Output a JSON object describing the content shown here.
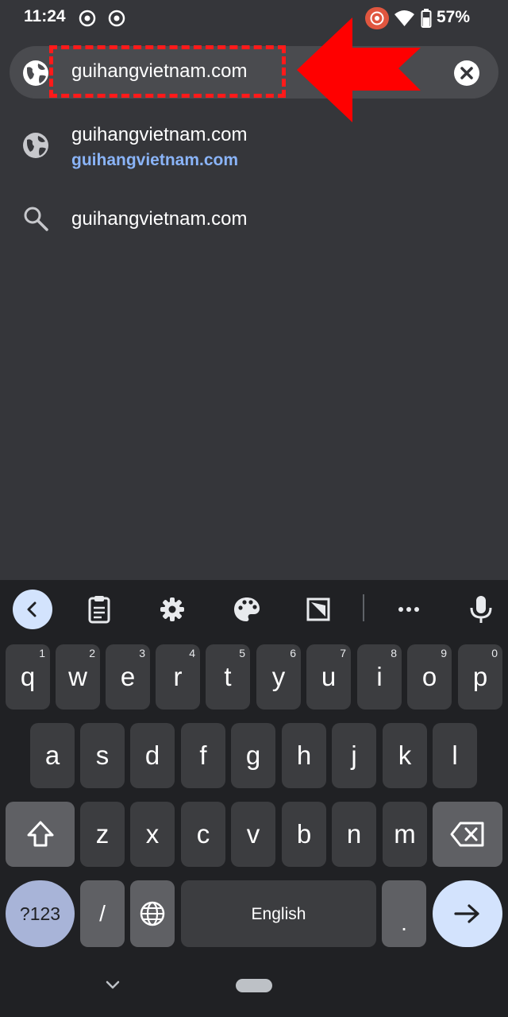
{
  "status_bar": {
    "time": "11:24",
    "battery": "57%",
    "icons": [
      "radar-icon",
      "radar-icon",
      "screen-record-icon",
      "wifi-icon",
      "battery-icon"
    ]
  },
  "omnibox": {
    "value": "guihangvietnam.com",
    "left_icon": "globe-icon",
    "clear_icon": "clear-icon"
  },
  "annotation": {
    "color": "#ff0000",
    "shapes": [
      "dashed-highlight-box",
      "arrow-left-icon"
    ]
  },
  "suggestions": [
    {
      "icon": "globe-icon",
      "title": "guihangvietnam.com",
      "url": "guihangvietnam.com"
    },
    {
      "icon": "search-icon",
      "title": "guihangvietnam.com"
    }
  ],
  "keyboard": {
    "toolbar": [
      "back-icon",
      "clipboard-icon",
      "gear-icon",
      "palette-icon",
      "resize-icon",
      "more-icon",
      "mic-icon"
    ],
    "row1": [
      {
        "k": "q",
        "h": "1"
      },
      {
        "k": "w",
        "h": "2"
      },
      {
        "k": "e",
        "h": "3"
      },
      {
        "k": "r",
        "h": "4"
      },
      {
        "k": "t",
        "h": "5"
      },
      {
        "k": "y",
        "h": "6"
      },
      {
        "k": "u",
        "h": "7"
      },
      {
        "k": "i",
        "h": "8"
      },
      {
        "k": "o",
        "h": "9"
      },
      {
        "k": "p",
        "h": "0"
      }
    ],
    "row2": [
      "a",
      "s",
      "d",
      "f",
      "g",
      "h",
      "j",
      "k",
      "l"
    ],
    "row3": [
      "z",
      "x",
      "c",
      "v",
      "b",
      "n",
      "m"
    ],
    "bottom": {
      "symbols": "?123",
      "slash": "/",
      "space": "English",
      "period": "."
    },
    "colors": {
      "accent": "#d3e3fd",
      "symbols_key": "#a8b4d8"
    }
  }
}
